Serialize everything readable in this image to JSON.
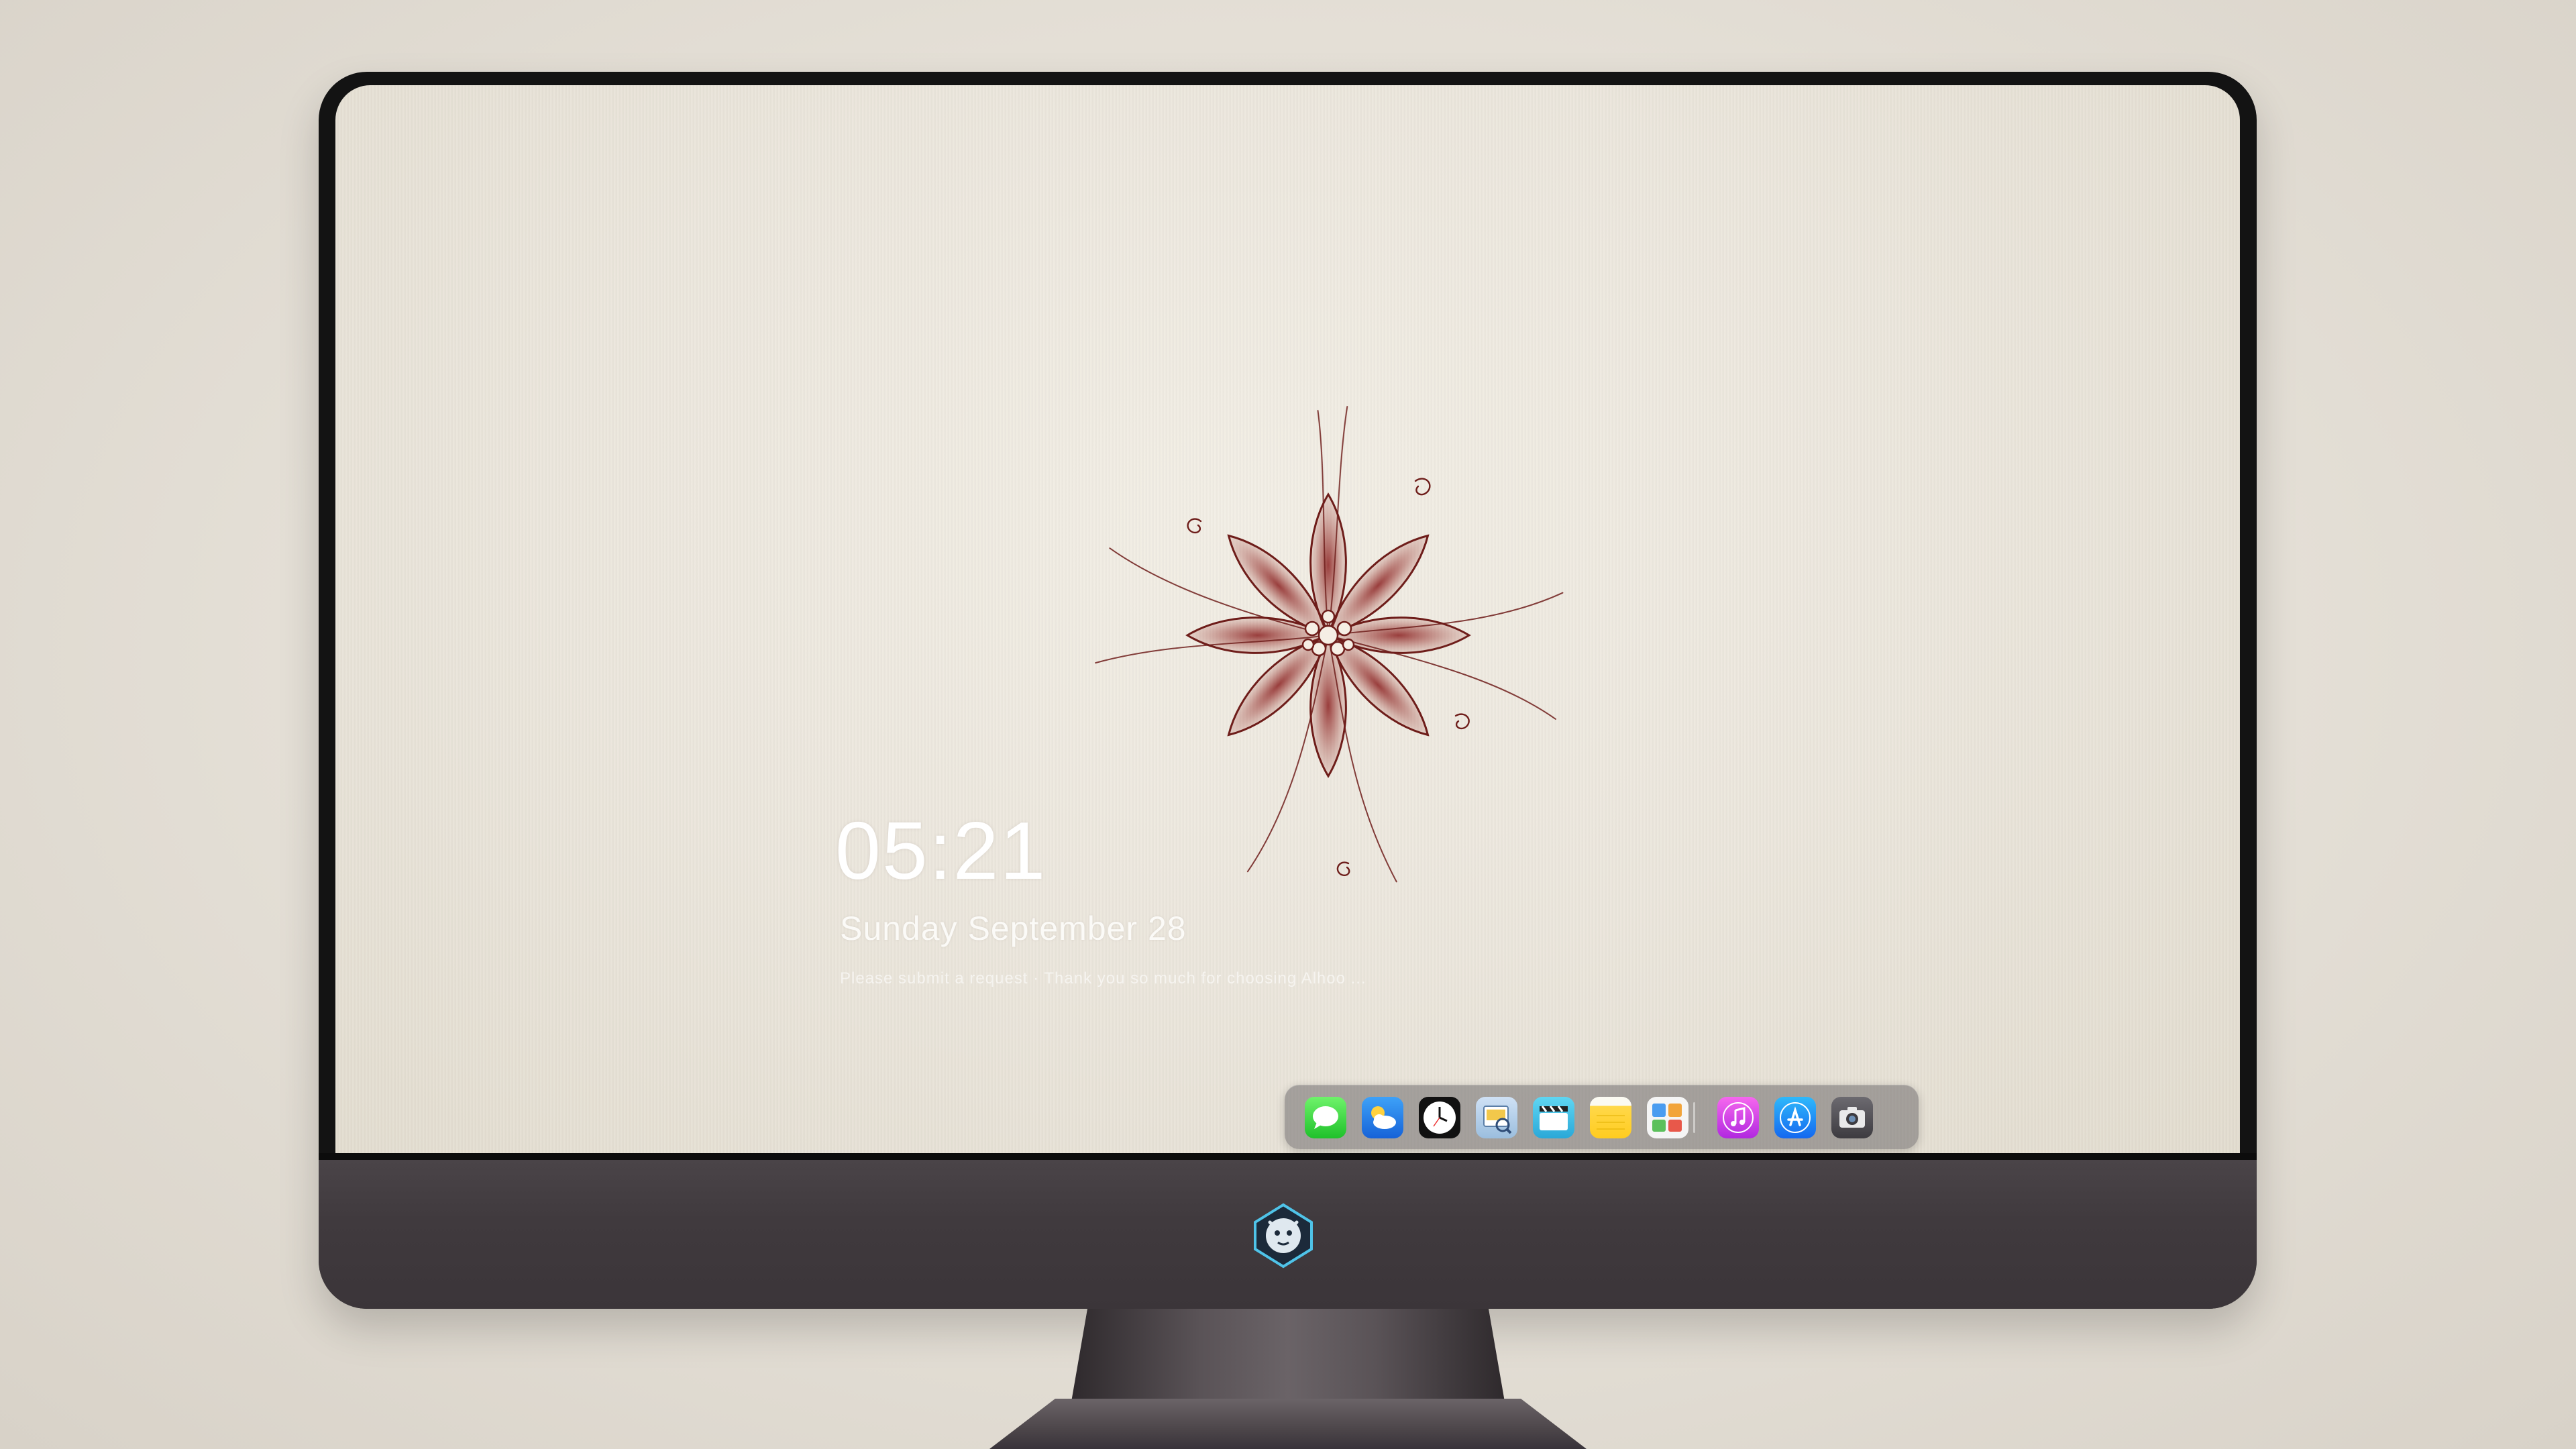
{
  "lockscreen": {
    "time": "05:21",
    "date": "Sunday September  28",
    "quote": "Please submit a request · Thank you so much for choosing Alhoo ..."
  },
  "dock": {
    "apps": [
      {
        "name": "Messages",
        "icon": "messages-icon"
      },
      {
        "name": "Weather",
        "icon": "weather-icon"
      },
      {
        "name": "Clock",
        "icon": "clock-icon"
      },
      {
        "name": "Preview",
        "icon": "preview-icon"
      },
      {
        "name": "Videos",
        "icon": "clapperboard-icon"
      },
      {
        "name": "Notes",
        "icon": "notes-icon"
      },
      {
        "name": "Photos",
        "icon": "photos-icon"
      },
      {
        "name": "Music",
        "icon": "music-note-icon"
      },
      {
        "name": "App Store",
        "icon": "app-store-icon"
      },
      {
        "name": "Camera",
        "icon": "camera-icon"
      }
    ]
  },
  "colors": {
    "wallpaper": "#ebe6dc",
    "flower": "#7a1c1c",
    "bezel": "#131313",
    "chin": "#423c40"
  }
}
